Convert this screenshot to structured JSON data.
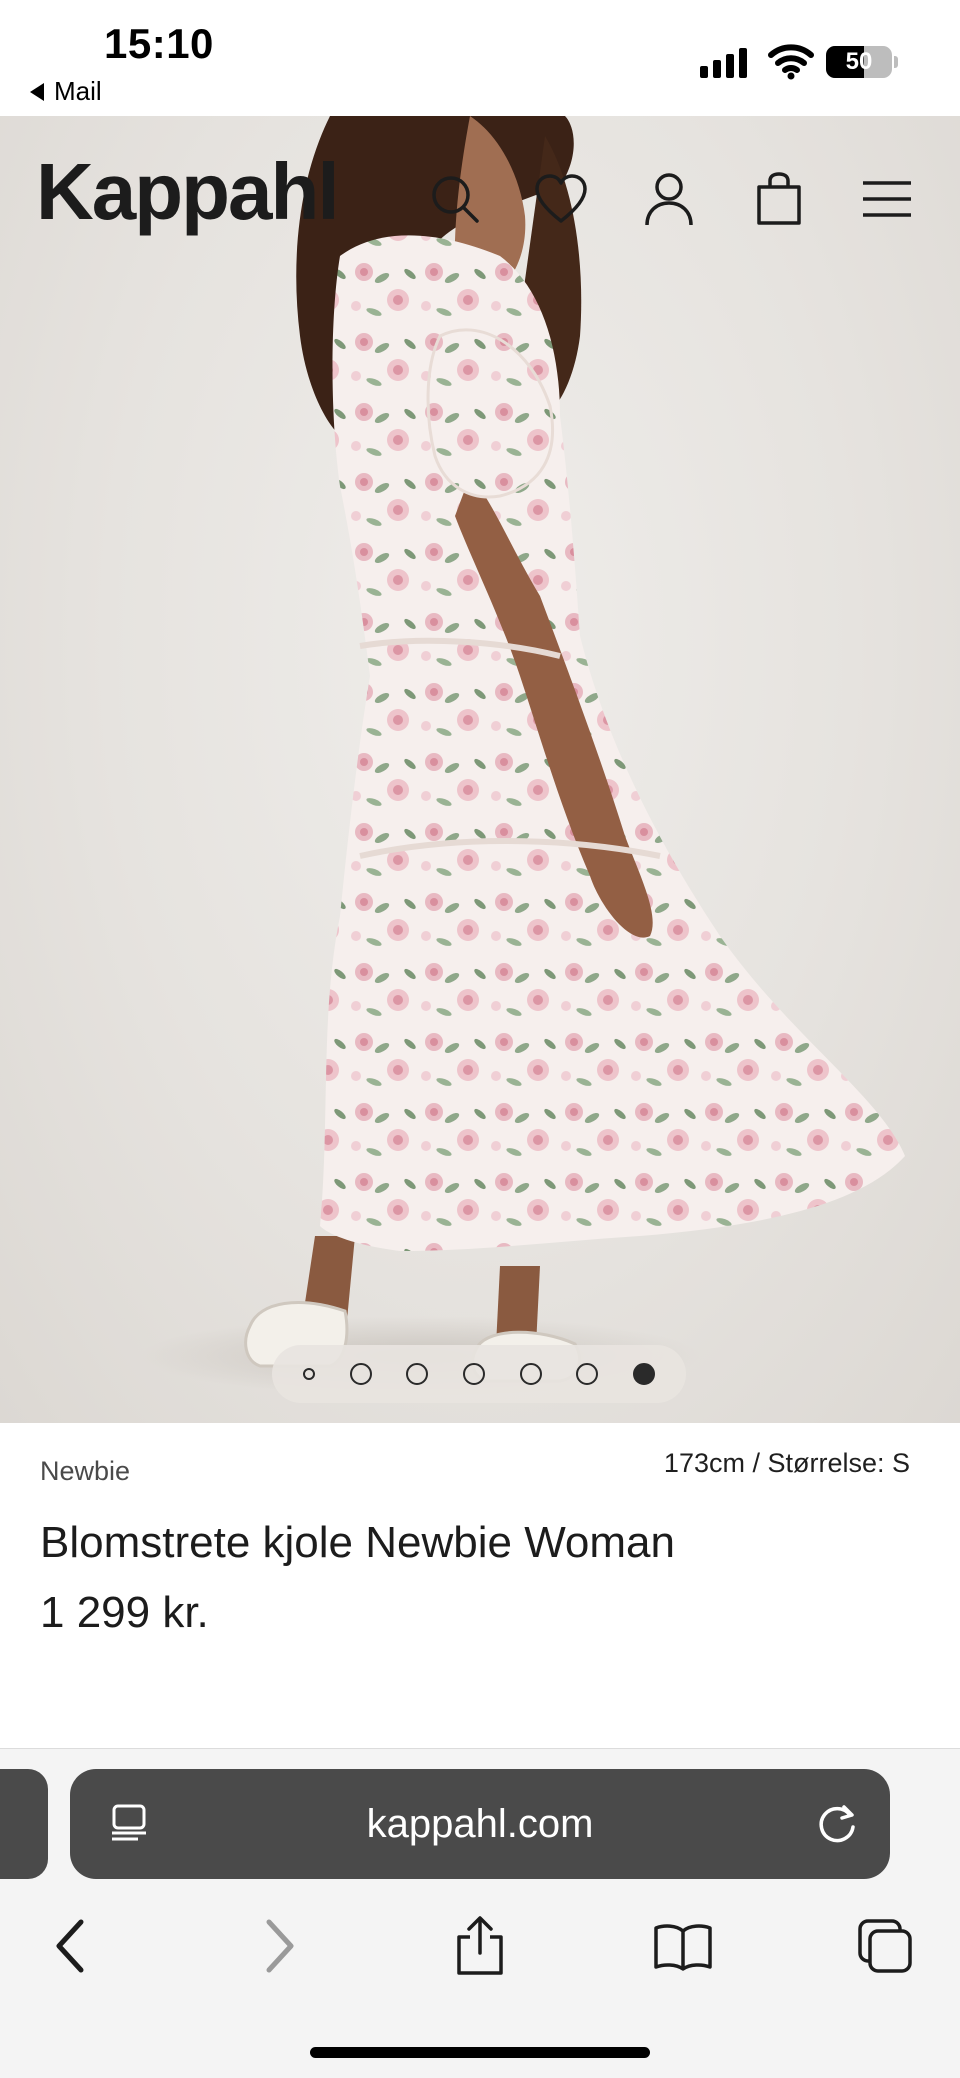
{
  "status_bar": {
    "time": "15:10",
    "back_label": "Mail",
    "battery": "50"
  },
  "header": {
    "logo": "Kappahl",
    "icons": [
      "search-icon",
      "heart-icon",
      "account-icon",
      "bag-icon",
      "menu-icon"
    ]
  },
  "carousel": {
    "count": 7,
    "active_index": 6
  },
  "product": {
    "brand": "Newbie",
    "model_info": "173cm /  Størrelse: S",
    "title": "Blomstrete kjole Newbie Woman",
    "price": "1 299 kr."
  },
  "browser": {
    "url": "kappahl.com",
    "toolbar": [
      "back-icon",
      "forward-icon",
      "share-icon",
      "bookmarks-icon",
      "tabs-icon"
    ]
  },
  "colors": {
    "accent": "#1c1c1c",
    "url_bar": "#4a4a4a",
    "dress_pink": "#e3a9b4",
    "leaf_green": "#7d9877"
  }
}
